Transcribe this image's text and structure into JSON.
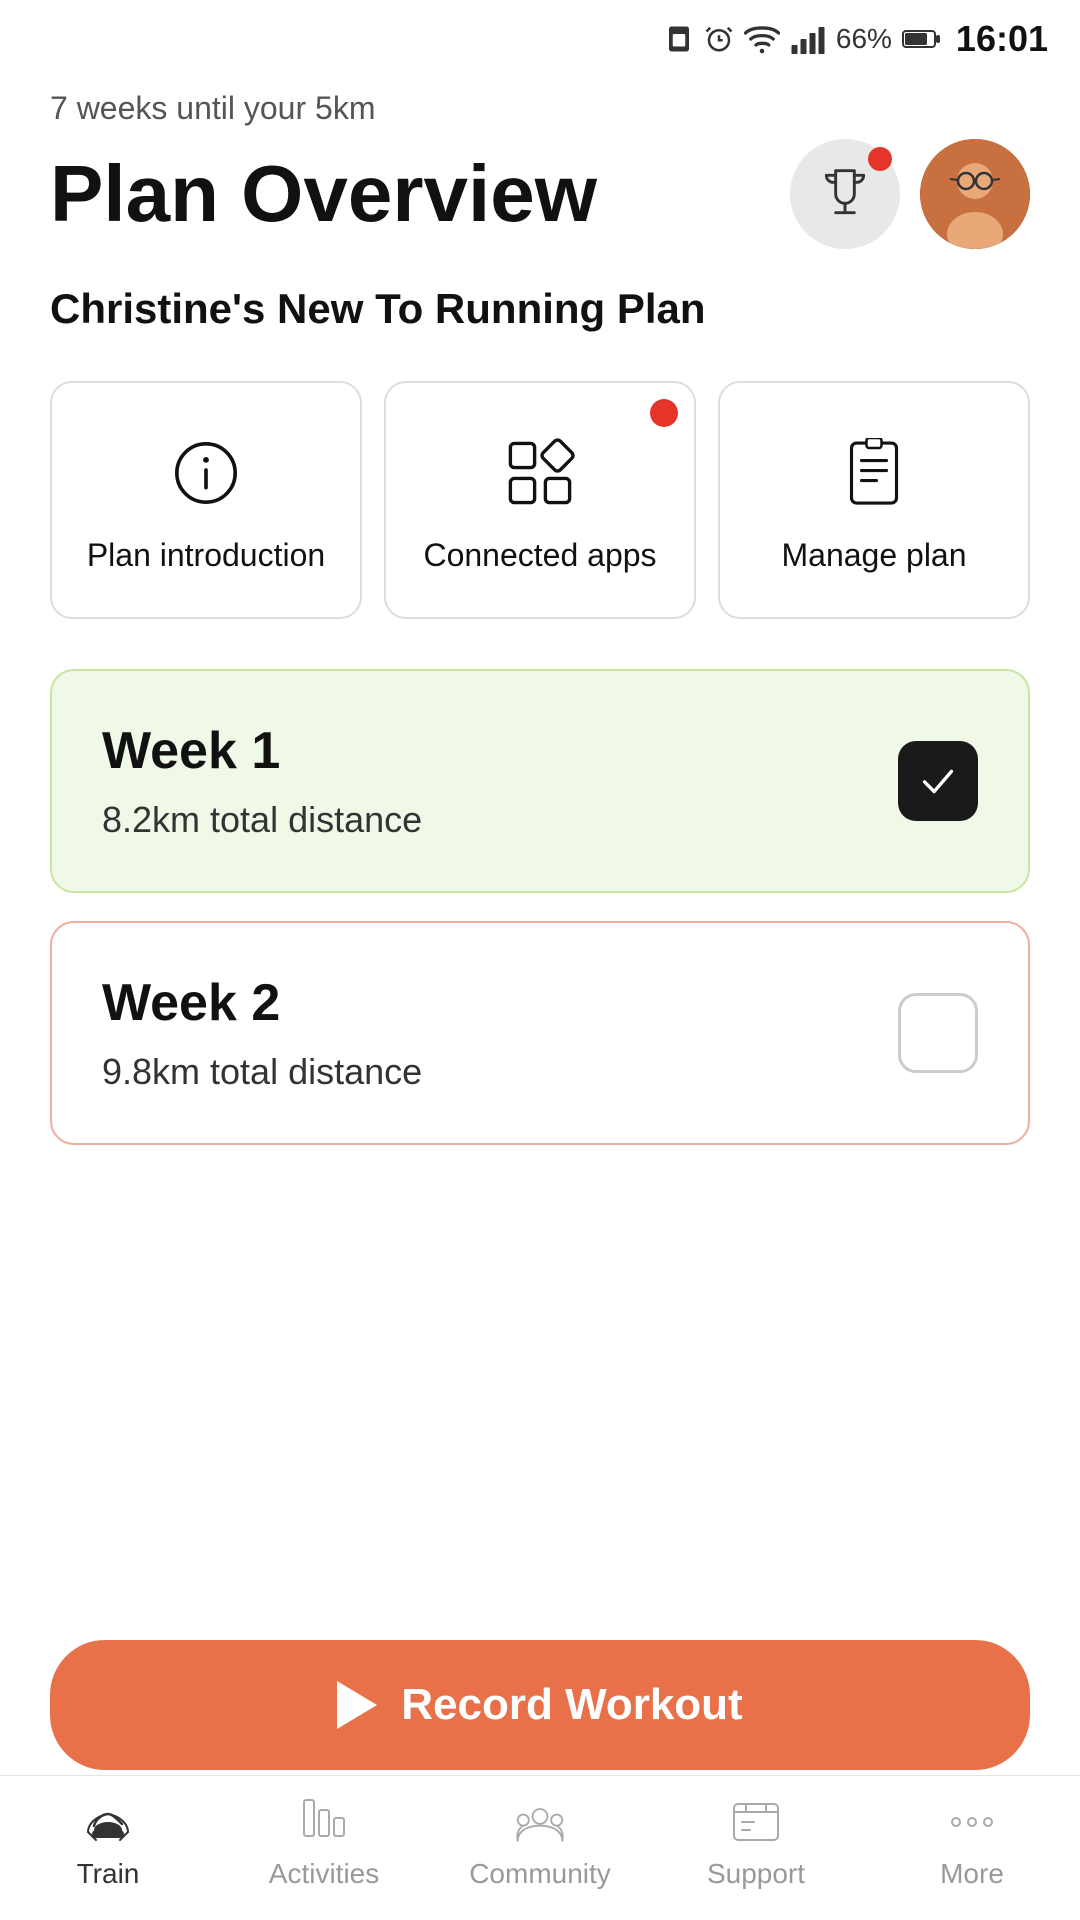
{
  "statusBar": {
    "time": "16:01",
    "batteryPct": "66%",
    "signal": "signal"
  },
  "header": {
    "subtitle": "7 weeks until your 5km",
    "title": "Plan Overview"
  },
  "planName": "Christine's New To Running Plan",
  "actionCards": [
    {
      "id": "plan-introduction",
      "label": "Plan introduction",
      "icon": "info",
      "hasNotification": false
    },
    {
      "id": "connected-apps",
      "label": "Connected apps",
      "icon": "apps",
      "hasNotification": true
    },
    {
      "id": "manage-plan",
      "label": "Manage plan",
      "icon": "clipboard",
      "hasNotification": false
    }
  ],
  "weeks": [
    {
      "id": "week-1",
      "title": "Week 1",
      "distance": "8.2km total distance",
      "completed": true
    },
    {
      "id": "week-2",
      "title": "Week 2",
      "distance": "9.8km total distance",
      "completed": false
    }
  ],
  "recordButton": {
    "label": "Record Workout"
  },
  "bottomNav": [
    {
      "id": "train",
      "label": "Train",
      "icon": "train",
      "active": true
    },
    {
      "id": "activities",
      "label": "Activities",
      "icon": "activities",
      "active": false
    },
    {
      "id": "community",
      "label": "Community",
      "icon": "community",
      "active": false
    },
    {
      "id": "support",
      "label": "Support",
      "icon": "support",
      "active": false
    },
    {
      "id": "more",
      "label": "More",
      "icon": "more",
      "active": false
    }
  ]
}
